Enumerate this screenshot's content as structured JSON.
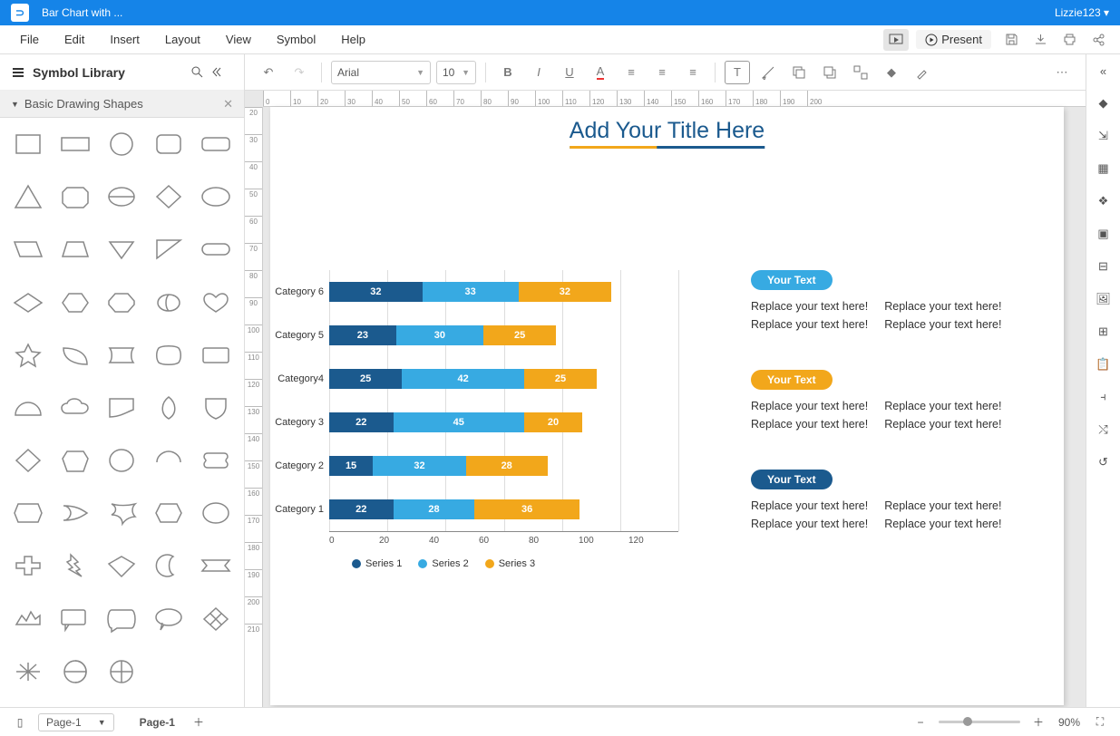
{
  "app": {
    "title": "Bar Chart with ...",
    "user": "Lizzie123"
  },
  "menubar": {
    "items": [
      "File",
      "Edit",
      "Insert",
      "Layout",
      "View",
      "Symbol",
      "Help"
    ],
    "present": "Present"
  },
  "toolbar": {
    "font": "Arial",
    "fontsize": "10"
  },
  "sidebar": {
    "title": "Symbol Library",
    "category": "Basic Drawing Shapes"
  },
  "page": {
    "title": "Add Your Title Here"
  },
  "textblocks": [
    {
      "pill": "Your Text",
      "color": "#37aae2",
      "c1": [
        "Replace your text here!",
        "Replace your text here!"
      ],
      "c2": [
        "Replace your text here!",
        "Replace your text here!"
      ]
    },
    {
      "pill": "Your Text",
      "color": "#f2a71b",
      "c1": [
        "Replace your text here!",
        "Replace your text here!"
      ],
      "c2": [
        "Replace your text here!",
        "Replace your text here!"
      ]
    },
    {
      "pill": "Your Text",
      "color": "#1b5a8e",
      "c1": [
        "Replace your text here!",
        "Replace your text here!"
      ],
      "c2": [
        "Replace your text here!",
        "Replace your text here!"
      ]
    }
  ],
  "status": {
    "page_active": "Page-1",
    "page_select": "Page-1",
    "zoom": "90%"
  },
  "chart_data": {
    "type": "bar",
    "orientation": "horizontal-stacked",
    "categories": [
      "Category 6",
      "Category 5",
      "Category4",
      "Category 3",
      "Category 2",
      "Category 1"
    ],
    "series": [
      {
        "name": "Series 1",
        "color": "#1b5a8e",
        "values": [
          32,
          23,
          25,
          22,
          15,
          22
        ]
      },
      {
        "name": "Series 2",
        "color": "#37aae2",
        "values": [
          33,
          30,
          42,
          45,
          32,
          28
        ]
      },
      {
        "name": "Series 3",
        "color": "#f2a71b",
        "values": [
          32,
          25,
          25,
          20,
          28,
          36
        ]
      }
    ],
    "xlim": [
      0,
      120
    ],
    "xticks": [
      0,
      20,
      40,
      60,
      80,
      100,
      120
    ],
    "legend": [
      "Series 1",
      "Series 2",
      "Series 3"
    ]
  }
}
